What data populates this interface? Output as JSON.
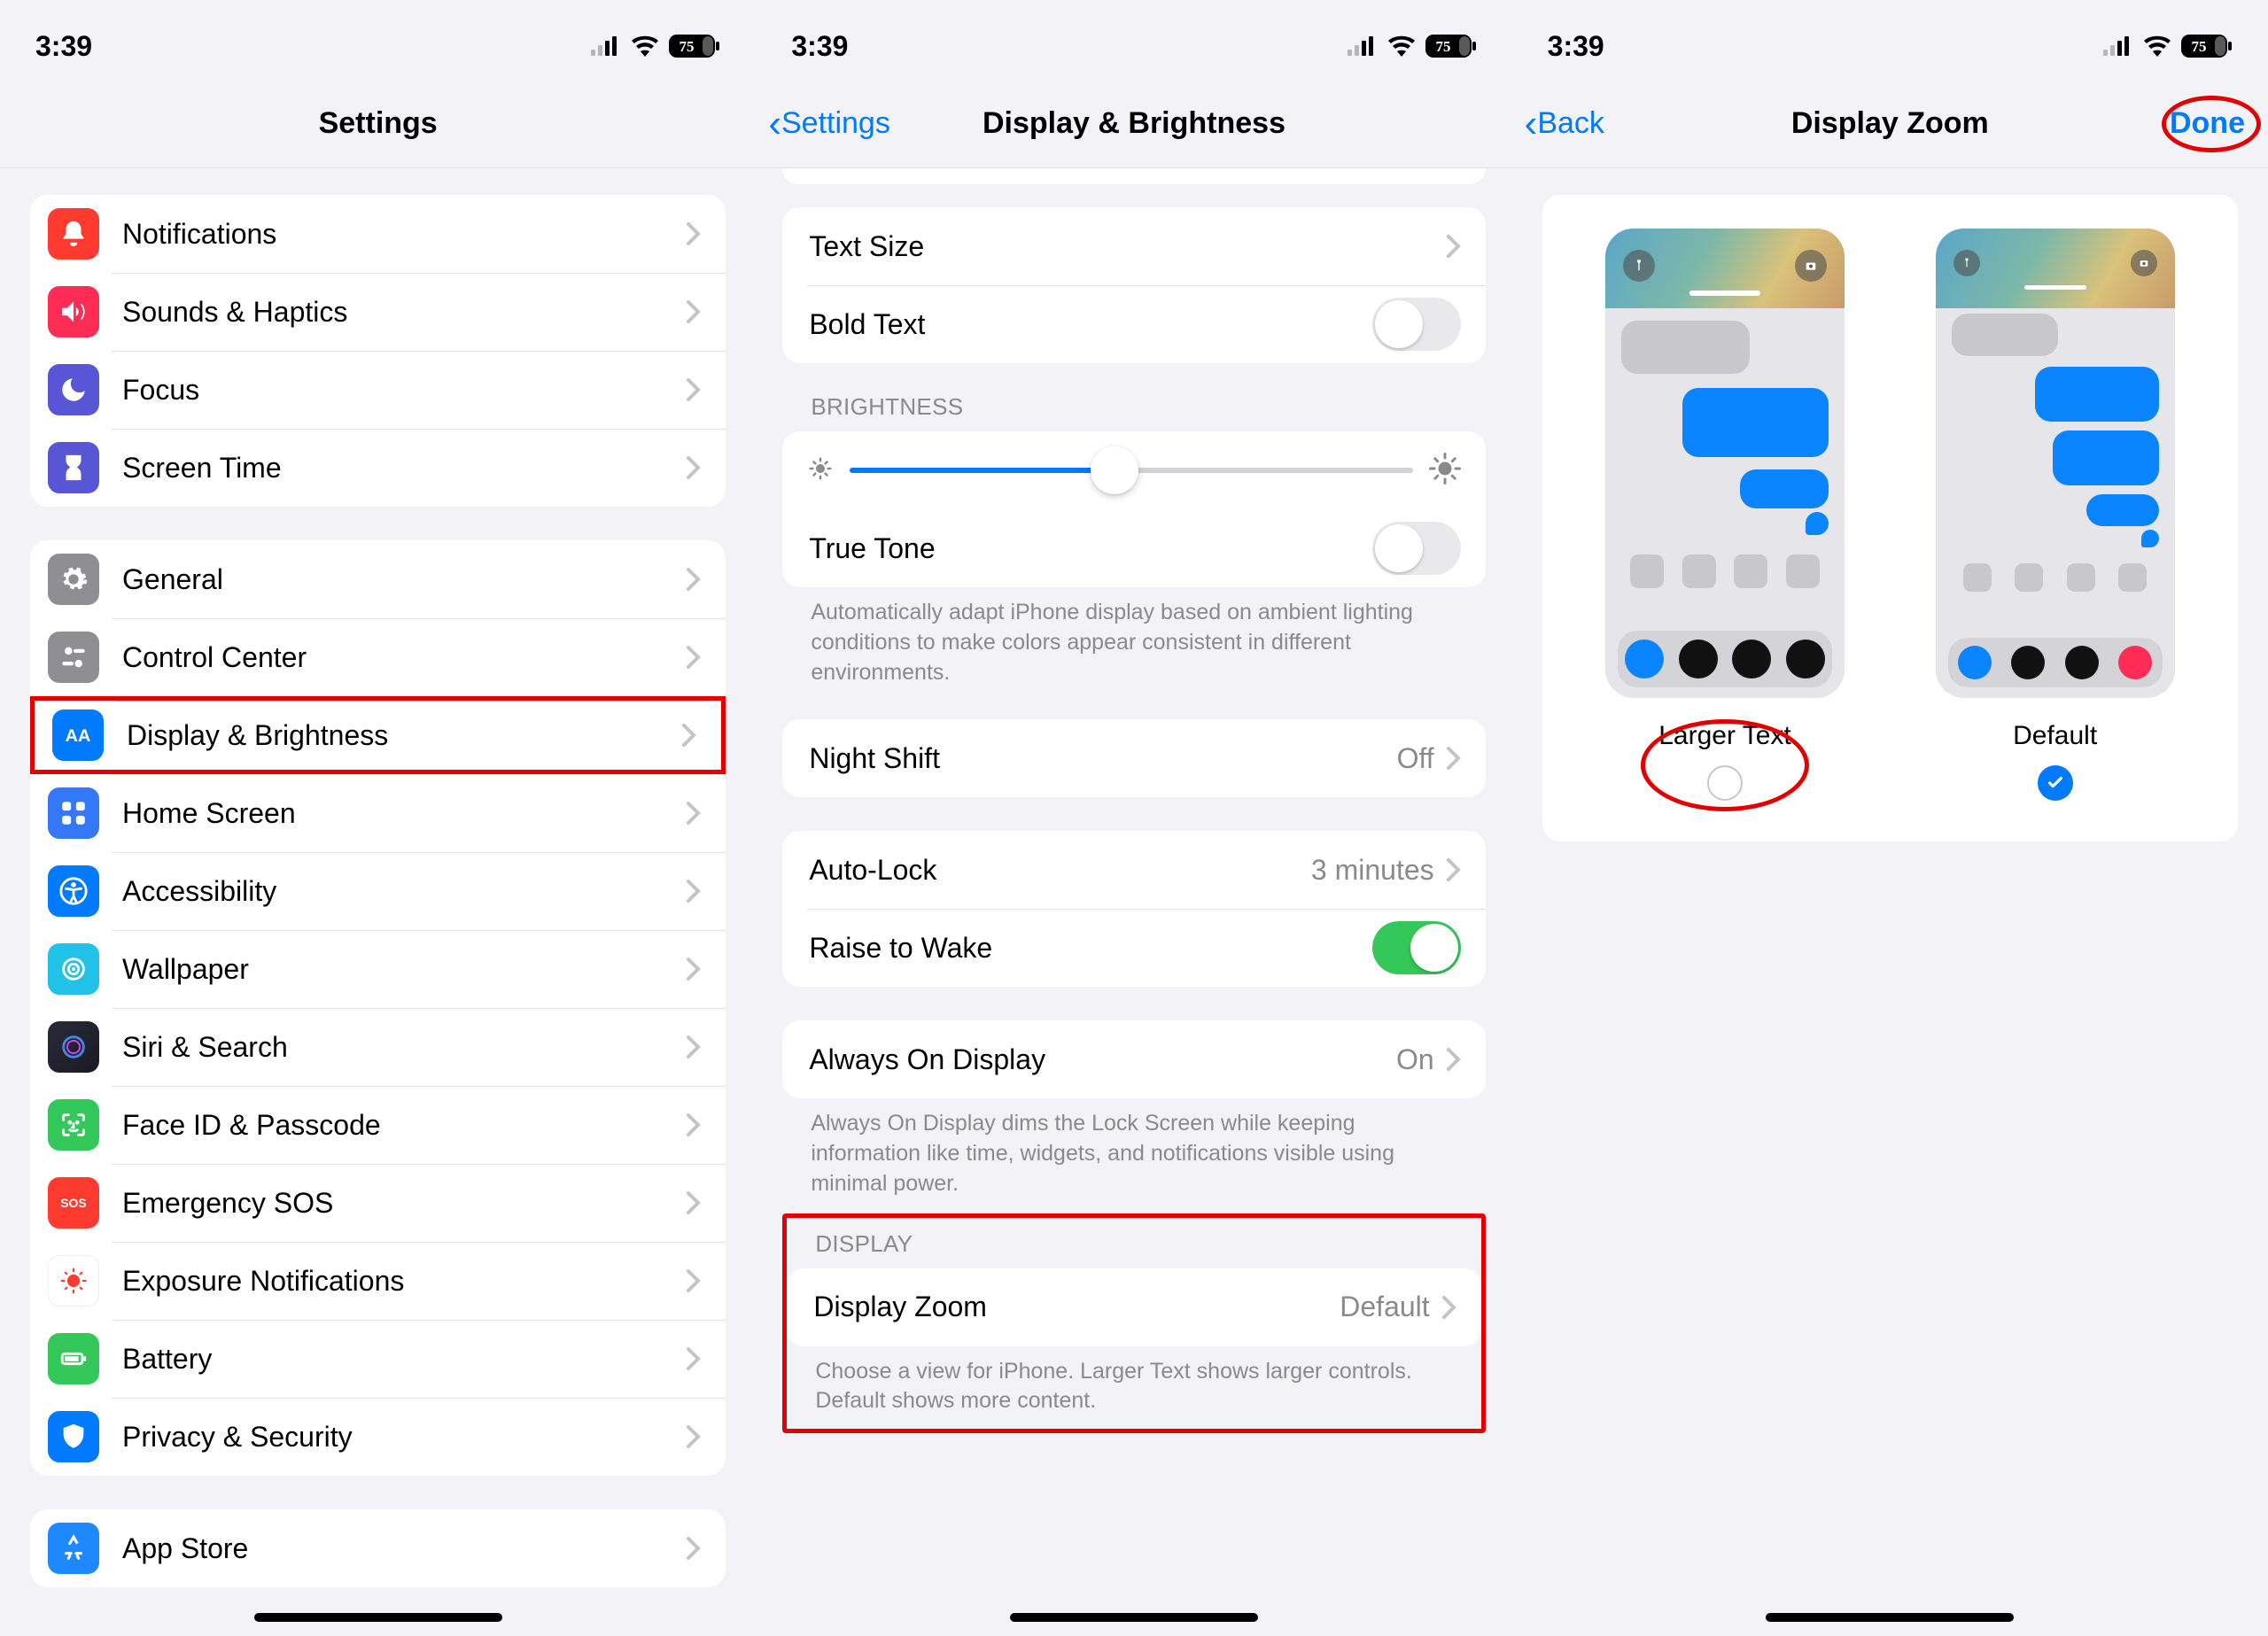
{
  "status": {
    "time": "3:39",
    "battery": "75"
  },
  "screen1": {
    "title": "Settings",
    "group1": [
      {
        "label": "Notifications"
      },
      {
        "label": "Sounds & Haptics"
      },
      {
        "label": "Focus"
      },
      {
        "label": "Screen Time"
      }
    ],
    "group2": [
      {
        "label": "General"
      },
      {
        "label": "Control Center"
      },
      {
        "label": "Display & Brightness"
      },
      {
        "label": "Home Screen"
      },
      {
        "label": "Accessibility"
      },
      {
        "label": "Wallpaper"
      },
      {
        "label": "Siri & Search"
      },
      {
        "label": "Face ID & Passcode"
      },
      {
        "label": "Emergency SOS"
      },
      {
        "label": "Exposure Notifications"
      },
      {
        "label": "Battery"
      },
      {
        "label": "Privacy & Security"
      }
    ],
    "group3": [
      {
        "label": "App Store"
      }
    ]
  },
  "screen2": {
    "back": "Settings",
    "title": "Display & Brightness",
    "text_size": "Text Size",
    "bold_text": "Bold Text",
    "brightness_header": "BRIGHTNESS",
    "brightness_value": 47,
    "true_tone": "True Tone",
    "tt_footer": "Automatically adapt iPhone display based on ambient lighting conditions to make colors appear consistent in different environments.",
    "night_shift": {
      "label": "Night Shift",
      "value": "Off"
    },
    "auto_lock": {
      "label": "Auto-Lock",
      "value": "3 minutes"
    },
    "raise_to_wake": "Raise to Wake",
    "aod": {
      "label": "Always On Display",
      "value": "On"
    },
    "aod_footer": "Always On Display dims the Lock Screen while keeping information like time, widgets, and notifications visible using minimal power.",
    "display_header": "DISPLAY",
    "display_zoom": {
      "label": "Display Zoom",
      "value": "Default"
    },
    "dz_footer": "Choose a view for iPhone. Larger Text shows larger controls. Default shows more content."
  },
  "screen3": {
    "back": "Back",
    "title": "Display Zoom",
    "done": "Done",
    "options": [
      {
        "label": "Larger Text",
        "selected": false
      },
      {
        "label": "Default",
        "selected": true
      }
    ]
  }
}
